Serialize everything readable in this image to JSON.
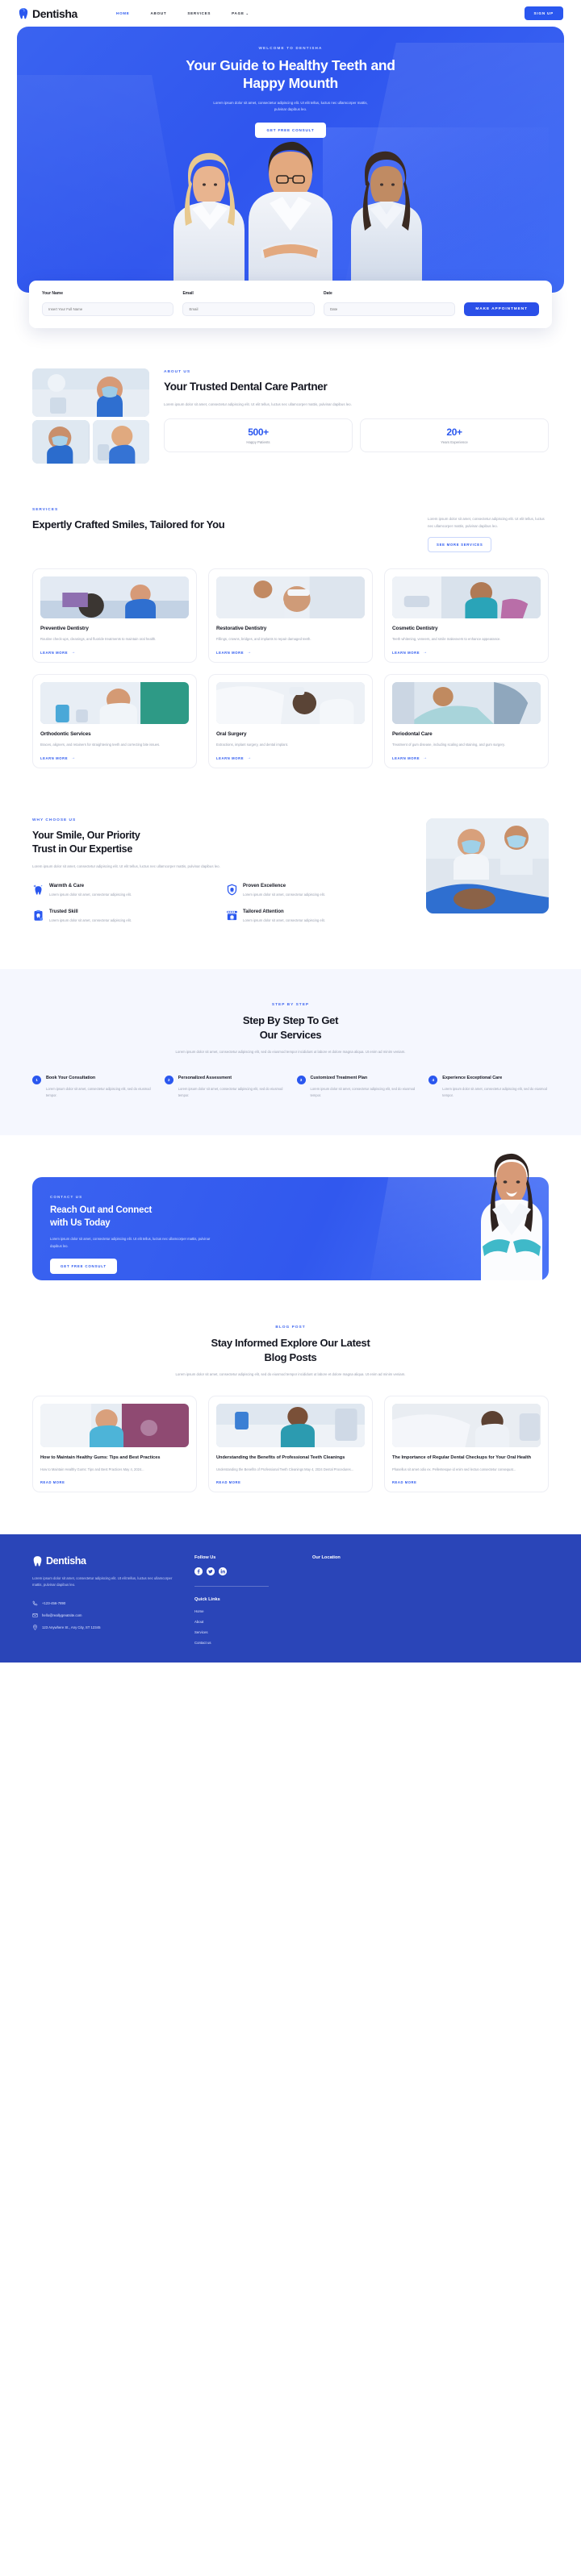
{
  "brand": {
    "name": "Dentisha",
    "logo_icon": "tooth-icon"
  },
  "header": {
    "nav": [
      {
        "label": "Home",
        "active": true
      },
      {
        "label": "About",
        "active": false
      },
      {
        "label": "Services",
        "active": false
      },
      {
        "label": "Page",
        "active": false,
        "caret": "⌄"
      }
    ],
    "signup_label": "Sign Up"
  },
  "hero": {
    "eyebrow": "WELCOME TO DENTISHA",
    "title_line1": "Your Guide to Healthy Teeth and",
    "title_line2": "Happy Mounth",
    "subtitle": "Lorem ipsum dolor sit amet, consectetur adipiscing elit. Ut elit tellus, luctus nec ullamcorper mattis, pulvinar dapibus leo.",
    "cta_label": "Get Free Consult"
  },
  "appointment": {
    "fields": [
      {
        "label": "Your Name",
        "placeholder": "Insert Your Full Name",
        "value": ""
      },
      {
        "label": "Email",
        "placeholder": "Email",
        "value": ""
      },
      {
        "label": "Date",
        "placeholder": "Date",
        "value": ""
      }
    ],
    "submit_label": "Make Appointment"
  },
  "about": {
    "eyebrow": "ABOUT US",
    "title": "Your Trusted Dental Care Partner",
    "text": "Lorem ipsum dolor sit amet, consectetur adipiscing elit. Ut elit tellus, luctus nec ullamcorper mattis, pulvinar dapibus leo.",
    "stats": [
      {
        "number": "500+",
        "label": "Happy Patients"
      },
      {
        "number": "20+",
        "label": "Years Experience"
      }
    ]
  },
  "services": {
    "eyebrow": "SERVICES",
    "title": "Expertly Crafted Smiles, Tailored for You",
    "side_text": "Lorem ipsum dolor sit amet, consectetur adipiscing elit. Ut elit tellus, luctus nec ullamcorper mattis, pulvinar dapibus leo.",
    "more_label": "See More Services",
    "learn_label": "Learn More",
    "items": [
      {
        "title": "Preventive Dentistry",
        "text": "Routine check-ups, cleanings, and fluoride treatments to maintain oral health."
      },
      {
        "title": "Restorative Dentistry",
        "text": "Fillings, crowns, bridges, and implants to repair damaged teeth."
      },
      {
        "title": "Cosmetic Dentistry",
        "text": "Teeth whitening, veneers, and smile makeovers to enhance appearance."
      },
      {
        "title": "Orthodontic Services",
        "text": "Braces, aligners, and retainers for straightening teeth and correcting bite issues."
      },
      {
        "title": "Oral Surgery",
        "text": "Extractions, implant surgery, and dental implant."
      },
      {
        "title": "Periodontal Care",
        "text": "Treatment of gum disease, including scaling and staining, and gum surgery."
      }
    ]
  },
  "why": {
    "eyebrow": "WHY CHOOSE US",
    "title_line1": "Your Smile, Our Priority",
    "title_line2": "Trust in Our Expertise",
    "text": "Lorem ipsum dolor sit amet, consectetur adipiscing elit. Ut elit tellus, luctus nec ullamcorper mattis, pulvinar dapibus leo.",
    "features": [
      {
        "name": "Warmth & Care",
        "text": "Lorem ipsum dolor sit amet, consectetur adipiscing elit.",
        "icon": "sparkle-tooth-icon"
      },
      {
        "name": "Proven Excellence",
        "text": "Lorem ipsum dolor sit amet, consectetur adipiscing elit.",
        "icon": "shield-tooth-icon"
      },
      {
        "name": "Trusted Skill",
        "text": "Lorem ipsum dolor sit amet, consectetur adipiscing elit.",
        "icon": "clipboard-tooth-icon"
      },
      {
        "name": "Tailored Attention",
        "text": "Lorem ipsum dolor sit amet, consectetur adipiscing elit.",
        "icon": "clinic-tooth-icon"
      }
    ]
  },
  "steps": {
    "eyebrow": "STEP BY STEP",
    "title_line1": "Step By Step To Get",
    "title_line2": "Our Services",
    "subtitle": "Lorem ipsum dolor sit amet, consectetur adipiscing elit, sed do eiusmod tempor incididunt ut labore et dolore magna aliqua. Ut enim ad minim veniam.",
    "items": [
      {
        "num": "1",
        "name": "Book Your Consultation",
        "text": "Lorem ipsum dolor sit amet, consectetur adipiscing elit, sed do eiusmod tempor."
      },
      {
        "num": "2",
        "name": "Personalized Assessment",
        "text": "Lorem ipsum dolor sit amet, consectetur adipiscing elit, sed do eiusmod tempor."
      },
      {
        "num": "3",
        "name": "Customized Treatment Plan",
        "text": "Lorem ipsum dolor sit amet, consectetur adipiscing elit, sed do eiusmod tempor."
      },
      {
        "num": "4",
        "name": "Experience Exceptional Care",
        "text": "Lorem ipsum dolor sit amet, consectetur adipiscing elit, sed do eiusmod tempor."
      }
    ]
  },
  "contact": {
    "eyebrow": "CONTACT US",
    "title_line1": "Reach Out and Connect",
    "title_line2": "with Us Today",
    "text": "Lorem ipsum dolor sit amet, consectetur adipiscing elit. Ut elit tellus, luctus nec ullamcorper mattis, pulvinar dapibus leo.",
    "cta_label": "Get Free Consult"
  },
  "blog": {
    "eyebrow": "BLOG POST",
    "title_line1": "Stay Informed Explore Our Latest",
    "title_line2": "Blog Posts",
    "subtitle": "Lorem ipsum dolor sit amet, consectetur adipiscing elit, sed do eiusmod tempor incididunt ut labore et dolore magna aliqua. Ut enim ad minim veniam.",
    "read_label": "Read More",
    "posts": [
      {
        "title": "How to Maintain Healthy Gums: Tips and Best Practices",
        "excerpt": "How to Maintain Healthy Gums: Tips and Best Practices May 4, 2024..."
      },
      {
        "title": "Understanding the Benefits of Professional Teeth Cleanings",
        "excerpt": "Understanding the Benefits of Professional Teeth Cleanings May 4, 2024 Dental Procedures..."
      },
      {
        "title": "The Importance of Regular Dental Checkups for Your Oral Health",
        "excerpt": "Phasellus sit amet odio ex. Pellentesque id enim sed lectus consectetur consequat..."
      }
    ]
  },
  "footer": {
    "brand_name": "Dentisha",
    "about_text": "Lorem ipsum dolor sit amet, consectetur adipiscing elit. Ut elit tellus, luctus nec ullamcorper mattis, pulvinar dapibus leo.",
    "contacts": [
      {
        "icon": "phone-icon",
        "value": "+123-456-7890"
      },
      {
        "icon": "mail-icon",
        "value": "hello@reallygreatsite.com"
      },
      {
        "icon": "location-icon",
        "value": "123 Anywhere St., Any City, ST 12345"
      }
    ],
    "follow_title": "Follow Us",
    "socials": [
      {
        "name": "facebook-icon",
        "glyph": "f"
      },
      {
        "name": "twitter-icon",
        "glyph": "ᵗ"
      },
      {
        "name": "linkedin-icon",
        "glyph": "in"
      }
    ],
    "quick_links_title": "Quick Links",
    "quick_links": [
      {
        "label": "Home"
      },
      {
        "label": "About"
      },
      {
        "label": "Services"
      },
      {
        "label": "Contact us"
      }
    ],
    "location_title": "Our Location"
  },
  "colors": {
    "primary": "#2a57ef",
    "hero_gradient_start": "#3a63f0",
    "footer_bg": "#2a45b8",
    "section_alt_bg": "#f5f7fe",
    "text_dark": "#141620",
    "text_muted": "#9aa0b0"
  }
}
